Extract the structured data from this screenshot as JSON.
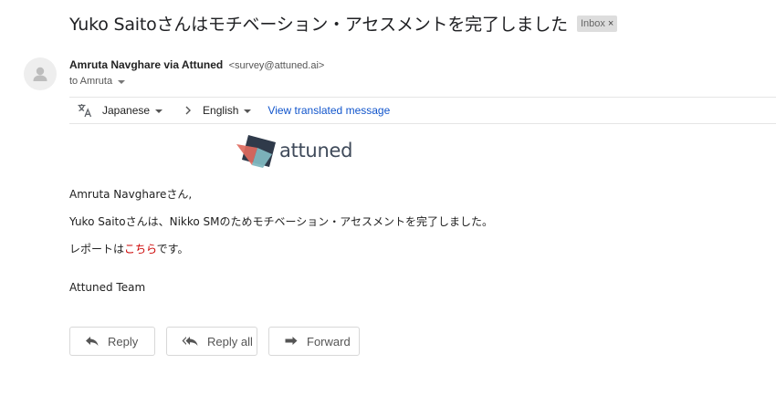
{
  "subject": "Yuko Saitoさんはモチベーション・アセスメントを完了しました",
  "inbox_label": "Inbox",
  "inbox_close": "×",
  "sender": {
    "name": "Amruta Navghare via Attuned",
    "email": "<survey@attuned.ai>",
    "to": "to Amruta"
  },
  "translation": {
    "source_language": "Japanese",
    "target_language": "English",
    "view_link": "View translated message"
  },
  "logo": {
    "text": "attuned"
  },
  "message": {
    "greeting": "Amruta Navghareさん,",
    "line1": "Yuko Saitoさんは、Nikko SMのためモチベーション・アセスメントを完了しました。",
    "line2_prefix": "レポートは",
    "line2_link": "こちら",
    "line2_suffix": "です。",
    "signature": "Attuned Team"
  },
  "actions": {
    "reply": "Reply",
    "reply_all": "Reply all",
    "forward": "Forward"
  },
  "colors": {
    "link_blue": "#1155cc",
    "link_red": "#cc0000",
    "logo_dark": "#2f3a4a",
    "logo_red": "#e06a5e",
    "logo_teal": "#7fb7bf"
  },
  "icons": [
    "person-icon",
    "translate-icon",
    "chevron-right-icon",
    "reply-icon",
    "reply-all-icon",
    "forward-icon"
  ]
}
